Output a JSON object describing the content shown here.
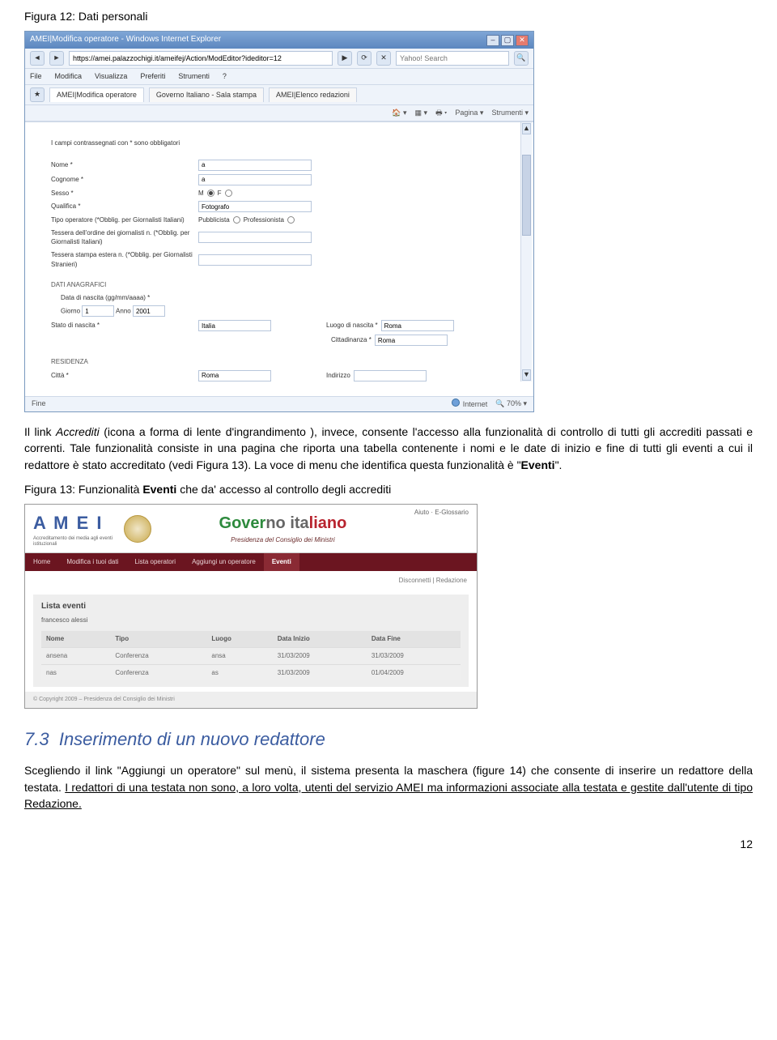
{
  "fig12": {
    "caption": "Figura 12: Dati personali",
    "window": {
      "title": "AMEI|Modifica operatore - Windows Internet Explorer",
      "url": "https://amei.palazzochigi.it/ameifej/Action/ModEditor?ideditor=12",
      "search_placeholder": "Yahoo! Search",
      "menus": [
        "File",
        "Modifica",
        "Visualizza",
        "Preferiti",
        "Strumenti",
        "?"
      ],
      "tabs": [
        "AMEI|Modifica operatore",
        "Governo Italiano - Sala stampa",
        "AMEI|Elenco redazioni"
      ],
      "toolbar_items": [
        "Pagina",
        "Strumenti"
      ],
      "mandatory_note": "I campi contrassegnati con * sono obbligatori",
      "fields": {
        "nome": "Nome *",
        "cognome": "Cognome *",
        "sesso": "Sesso *",
        "sesso_m": "M",
        "sesso_f": "F",
        "qualifica": "Qualifica *",
        "qualifica_val": "Fotografo",
        "tipo_op": "Tipo operatore (*Obblig. per Giornalisti Italiani)",
        "tipo_op_a": "Pubblicista",
        "tipo_op_b": "Professionista",
        "tessera_it": "Tessera dell'ordine dei giornalisti n. (*Obblig. per Giornalisti Italiani)",
        "tessera_est": "Tessera stampa estera n. (*Obblig. per Giornalisti Stranieri)",
        "sec_anagrafici": "DATI ANAGRAFICI",
        "data_nascita": "Data di nascita (gg/mm/aaaa) *",
        "giorno": "Giorno",
        "mese": "1",
        "anno": "Anno",
        "anno_val": "2001",
        "stato_nascita": "Stato di nascita *",
        "stato_nascita_val": "Italia",
        "luogo_nascita": "Luogo di nascita *",
        "luogo_nascita_val": "Roma",
        "cittadinanza": "Cittadinanza *",
        "cittadinanza_val": "Roma",
        "sec_residenza": "RESIDENZA",
        "citta": "Città *",
        "citta_val": "Roma",
        "indirizzo": "Indirizzo"
      },
      "status_left": "Fine",
      "status_net": "Internet",
      "status_zoom": "70%"
    }
  },
  "para1": {
    "t1": "Il link ",
    "t2": "Accrediti",
    "t3": " (icona a forma di lente d'ingrandimento ), invece, consente l'accesso alla funzionalità di controllo di tutti gli accrediti passati e correnti. Tale funzionalità consiste in una pagina che riporta una tabella contenente i nomi e le date di inizio e fine di tutti gli eventi a cui il redattore è stato accreditato (vedi Figura 13). La voce di menu che identifica questa funzionalità è \"",
    "t4": "Eventi",
    "t5": "\"."
  },
  "fig13": {
    "caption_a": "Figura 13: Funzionalità ",
    "caption_b": "Eventi",
    "caption_c": " che da' accesso al controllo degli accrediti",
    "amei_logo": "A M E I",
    "amei_logo_sub": "Accreditamento dei media agli eventi istituzionali",
    "gov_g": "Gover",
    "gov_n": "no ita",
    "gov_r": "liano",
    "gov_sub": "Presidenza del Consiglio dei Ministri",
    "util": "Aiuto · E-Glossario",
    "nav": [
      "Home",
      "Modifica i tuoi dati",
      "Lista operatori",
      "Aggiungi un operatore",
      "Eventi"
    ],
    "subnav": "Disconnetti | Redazione",
    "panel_title": "Lista eventi",
    "panel_sub": "francesco alessi",
    "th": [
      "Nome",
      "Tipo",
      "Luogo",
      "Data Inizio",
      "Data Fine"
    ],
    "rows": [
      [
        "ansena",
        "Conferenza",
        "ansa",
        "31/03/2009",
        "31/03/2009"
      ],
      [
        "nas",
        "Conferenza",
        "as",
        "31/03/2009",
        "01/04/2009"
      ]
    ],
    "footer": "© Copyright 2009 – Presidenza del Consiglio dei Ministri"
  },
  "section": {
    "num": "7.3",
    "title": "Inserimento di un nuovo redattore"
  },
  "para2": {
    "t1": "Scegliendo il link \"Aggiungi un operatore\" sul menù, il sistema presenta la maschera (figure 14) che consente di inserire un redattore della testata. ",
    "t2": "I redattori di una testata non sono, a loro volta, utenti del servizio AMEI ma informazioni associate alla testata e gestite dall'utente di tipo Redazione."
  },
  "pagenum": "12"
}
